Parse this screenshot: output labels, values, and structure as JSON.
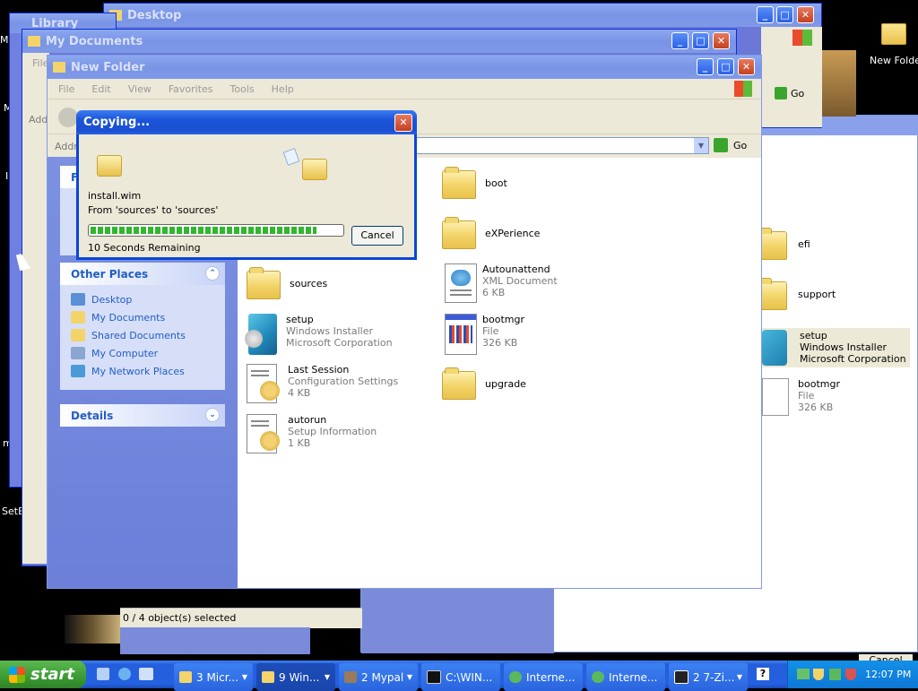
{
  "desktop": {
    "new_folder_label": "New Folder",
    "left_fragments": [
      "M",
      "M",
      "I",
      "m",
      "SetE"
    ]
  },
  "windows": {
    "desktop_win": {
      "title": "Desktop",
      "go": "Go"
    },
    "library_win": {
      "title": "Library"
    },
    "mydocs_win": {
      "title": "My Documents",
      "menu_fragment": "File",
      "address_fragment": "Add"
    },
    "right_win": {
      "status": "0 / 4 object(s) selected",
      "cancel_fragment": "Cancel"
    }
  },
  "explorer": {
    "title": "New Folder",
    "menu": [
      "File",
      "Edit",
      "View",
      "Favorites",
      "Tools",
      "Help"
    ],
    "address_label": "Addre",
    "go": "Go",
    "tasks_fragment": "F",
    "other_places": {
      "header": "Other Places",
      "items": [
        "Desktop",
        "My Documents",
        "Shared Documents",
        "My Computer",
        "My Network Places"
      ]
    },
    "details": {
      "header": "Details"
    },
    "items": [
      {
        "name": "boot",
        "type": "",
        "extra": ""
      },
      {
        "name": "eXPerience",
        "type": "",
        "extra": ""
      },
      {
        "name": "sources",
        "type": "",
        "extra": ""
      },
      {
        "name": "Autounattend",
        "type": "XML Document",
        "extra": "6 KB"
      },
      {
        "name": "setup",
        "type": "Windows Installer",
        "extra": "Microsoft Corporation"
      },
      {
        "name": "bootmgr",
        "type": "File",
        "extra": "326 KB"
      },
      {
        "name": "Last Session",
        "type": "Configuration Settings",
        "extra": "4 KB"
      },
      {
        "name": "upgrade",
        "type": "",
        "extra": ""
      },
      {
        "name": "autorun",
        "type": "Setup Information",
        "extra": "1 KB"
      }
    ]
  },
  "background_items": [
    {
      "name": "efi",
      "type": "",
      "extra": ""
    },
    {
      "name": "support",
      "type": "",
      "extra": ""
    },
    {
      "name": "setup",
      "type": "Windows Installer",
      "extra": "Microsoft Corporation"
    },
    {
      "name": "bootmgr",
      "type": "File",
      "extra": "326 KB"
    }
  ],
  "copy_dialog": {
    "title": "Copying...",
    "filename": "install.wim",
    "from_to": "From 'sources' to 'sources'",
    "remaining": "10 Seconds Remaining",
    "cancel": "Cancel",
    "progress": 0.9
  },
  "taskbar": {
    "start": "start",
    "buttons": [
      {
        "label": "3 Micr...",
        "icon": "multi-icon"
      },
      {
        "label": "9 Win...",
        "icon": "folder-icon"
      },
      {
        "label": "2 Mypal",
        "icon": "mypal-icon"
      },
      {
        "label": "C:\\WIN...",
        "icon": "cmd-icon"
      },
      {
        "label": "Interne...",
        "icon": "ie-icon"
      },
      {
        "label": "Interne...",
        "icon": "ie-icon"
      },
      {
        "label": "2 7-Zi...",
        "icon": "7zip-icon"
      }
    ],
    "clock": "12:07 PM"
  },
  "colors": {
    "xp_blue": "#245edb",
    "panel_link": "#215dc6",
    "progress_green": "#31b62e"
  }
}
